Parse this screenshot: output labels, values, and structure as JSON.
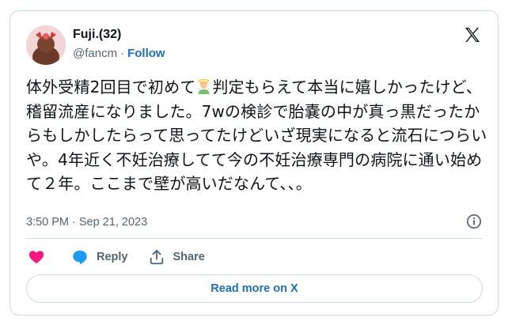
{
  "author": {
    "display_name": "Fuji.(32)",
    "handle": "@fancm",
    "separator": "·",
    "follow_label": "Follow"
  },
  "tweet": {
    "text_before_emoji": "体外受精2回目で初めて",
    "text_after_emoji": "判定もらえて本当に嬉しかったけど、稽留流産になりました。7wの検診で胎嚢の中が真っ黒だったからもしかしたらって思ってたけどいざ現実になると流石につらいや。4年近く不妊治療してて今の不妊治療専門の病院に通い始めて２年。ここまで壁が高いだなんて、、。",
    "emoji_name": "person-with-halo-emoji",
    "timestamp": "3:50 PM · Sep 21, 2023"
  },
  "actions": {
    "reply_label": "Reply",
    "share_label": "Share"
  },
  "read_more_label": "Read more on X",
  "colors": {
    "accent": "#1d6fb8",
    "heart": "#f91880",
    "text": "#0f1419",
    "muted": "#536471",
    "border": "#cfd9de"
  },
  "icons": [
    "x-logo-icon",
    "info-icon",
    "heart-icon",
    "reply-bubble-icon",
    "share-icon"
  ]
}
